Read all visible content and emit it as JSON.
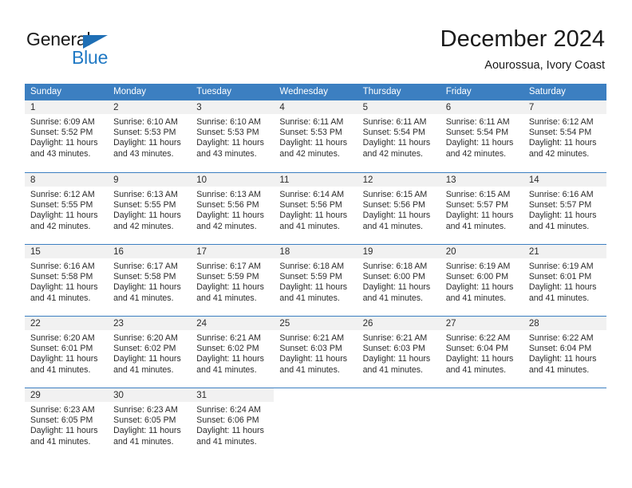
{
  "logo": {
    "word_one": "General",
    "word_two": "Blue",
    "triangle_icon": "triangle-icon",
    "color_dark": "#1a1a1a",
    "color_blue": "#2079c4"
  },
  "header": {
    "title": "December 2024",
    "subtitle": "Aourossua, Ivory Coast"
  },
  "theme": {
    "header_bg": "#3c7fc1",
    "daynum_bg": "#f1f1f1",
    "text": "#2b2b2b"
  },
  "calendar": {
    "weekday_headers": [
      "Sunday",
      "Monday",
      "Tuesday",
      "Wednesday",
      "Thursday",
      "Friday",
      "Saturday"
    ],
    "weeks": [
      [
        {
          "day": "1",
          "sunrise": "Sunrise: 6:09 AM",
          "sunset": "Sunset: 5:52 PM",
          "daylight_line1": "Daylight: 11 hours",
          "daylight_line2": "and 43 minutes."
        },
        {
          "day": "2",
          "sunrise": "Sunrise: 6:10 AM",
          "sunset": "Sunset: 5:53 PM",
          "daylight_line1": "Daylight: 11 hours",
          "daylight_line2": "and 43 minutes."
        },
        {
          "day": "3",
          "sunrise": "Sunrise: 6:10 AM",
          "sunset": "Sunset: 5:53 PM",
          "daylight_line1": "Daylight: 11 hours",
          "daylight_line2": "and 43 minutes."
        },
        {
          "day": "4",
          "sunrise": "Sunrise: 6:11 AM",
          "sunset": "Sunset: 5:53 PM",
          "daylight_line1": "Daylight: 11 hours",
          "daylight_line2": "and 42 minutes."
        },
        {
          "day": "5",
          "sunrise": "Sunrise: 6:11 AM",
          "sunset": "Sunset: 5:54 PM",
          "daylight_line1": "Daylight: 11 hours",
          "daylight_line2": "and 42 minutes."
        },
        {
          "day": "6",
          "sunrise": "Sunrise: 6:11 AM",
          "sunset": "Sunset: 5:54 PM",
          "daylight_line1": "Daylight: 11 hours",
          "daylight_line2": "and 42 minutes."
        },
        {
          "day": "7",
          "sunrise": "Sunrise: 6:12 AM",
          "sunset": "Sunset: 5:54 PM",
          "daylight_line1": "Daylight: 11 hours",
          "daylight_line2": "and 42 minutes."
        }
      ],
      [
        {
          "day": "8",
          "sunrise": "Sunrise: 6:12 AM",
          "sunset": "Sunset: 5:55 PM",
          "daylight_line1": "Daylight: 11 hours",
          "daylight_line2": "and 42 minutes."
        },
        {
          "day": "9",
          "sunrise": "Sunrise: 6:13 AM",
          "sunset": "Sunset: 5:55 PM",
          "daylight_line1": "Daylight: 11 hours",
          "daylight_line2": "and 42 minutes."
        },
        {
          "day": "10",
          "sunrise": "Sunrise: 6:13 AM",
          "sunset": "Sunset: 5:56 PM",
          "daylight_line1": "Daylight: 11 hours",
          "daylight_line2": "and 42 minutes."
        },
        {
          "day": "11",
          "sunrise": "Sunrise: 6:14 AM",
          "sunset": "Sunset: 5:56 PM",
          "daylight_line1": "Daylight: 11 hours",
          "daylight_line2": "and 41 minutes."
        },
        {
          "day": "12",
          "sunrise": "Sunrise: 6:15 AM",
          "sunset": "Sunset: 5:56 PM",
          "daylight_line1": "Daylight: 11 hours",
          "daylight_line2": "and 41 minutes."
        },
        {
          "day": "13",
          "sunrise": "Sunrise: 6:15 AM",
          "sunset": "Sunset: 5:57 PM",
          "daylight_line1": "Daylight: 11 hours",
          "daylight_line2": "and 41 minutes."
        },
        {
          "day": "14",
          "sunrise": "Sunrise: 6:16 AM",
          "sunset": "Sunset: 5:57 PM",
          "daylight_line1": "Daylight: 11 hours",
          "daylight_line2": "and 41 minutes."
        }
      ],
      [
        {
          "day": "15",
          "sunrise": "Sunrise: 6:16 AM",
          "sunset": "Sunset: 5:58 PM",
          "daylight_line1": "Daylight: 11 hours",
          "daylight_line2": "and 41 minutes."
        },
        {
          "day": "16",
          "sunrise": "Sunrise: 6:17 AM",
          "sunset": "Sunset: 5:58 PM",
          "daylight_line1": "Daylight: 11 hours",
          "daylight_line2": "and 41 minutes."
        },
        {
          "day": "17",
          "sunrise": "Sunrise: 6:17 AM",
          "sunset": "Sunset: 5:59 PM",
          "daylight_line1": "Daylight: 11 hours",
          "daylight_line2": "and 41 minutes."
        },
        {
          "day": "18",
          "sunrise": "Sunrise: 6:18 AM",
          "sunset": "Sunset: 5:59 PM",
          "daylight_line1": "Daylight: 11 hours",
          "daylight_line2": "and 41 minutes."
        },
        {
          "day": "19",
          "sunrise": "Sunrise: 6:18 AM",
          "sunset": "Sunset: 6:00 PM",
          "daylight_line1": "Daylight: 11 hours",
          "daylight_line2": "and 41 minutes."
        },
        {
          "day": "20",
          "sunrise": "Sunrise: 6:19 AM",
          "sunset": "Sunset: 6:00 PM",
          "daylight_line1": "Daylight: 11 hours",
          "daylight_line2": "and 41 minutes."
        },
        {
          "day": "21",
          "sunrise": "Sunrise: 6:19 AM",
          "sunset": "Sunset: 6:01 PM",
          "daylight_line1": "Daylight: 11 hours",
          "daylight_line2": "and 41 minutes."
        }
      ],
      [
        {
          "day": "22",
          "sunrise": "Sunrise: 6:20 AM",
          "sunset": "Sunset: 6:01 PM",
          "daylight_line1": "Daylight: 11 hours",
          "daylight_line2": "and 41 minutes."
        },
        {
          "day": "23",
          "sunrise": "Sunrise: 6:20 AM",
          "sunset": "Sunset: 6:02 PM",
          "daylight_line1": "Daylight: 11 hours",
          "daylight_line2": "and 41 minutes."
        },
        {
          "day": "24",
          "sunrise": "Sunrise: 6:21 AM",
          "sunset": "Sunset: 6:02 PM",
          "daylight_line1": "Daylight: 11 hours",
          "daylight_line2": "and 41 minutes."
        },
        {
          "day": "25",
          "sunrise": "Sunrise: 6:21 AM",
          "sunset": "Sunset: 6:03 PM",
          "daylight_line1": "Daylight: 11 hours",
          "daylight_line2": "and 41 minutes."
        },
        {
          "day": "26",
          "sunrise": "Sunrise: 6:21 AM",
          "sunset": "Sunset: 6:03 PM",
          "daylight_line1": "Daylight: 11 hours",
          "daylight_line2": "and 41 minutes."
        },
        {
          "day": "27",
          "sunrise": "Sunrise: 6:22 AM",
          "sunset": "Sunset: 6:04 PM",
          "daylight_line1": "Daylight: 11 hours",
          "daylight_line2": "and 41 minutes."
        },
        {
          "day": "28",
          "sunrise": "Sunrise: 6:22 AM",
          "sunset": "Sunset: 6:04 PM",
          "daylight_line1": "Daylight: 11 hours",
          "daylight_line2": "and 41 minutes."
        }
      ],
      [
        {
          "day": "29",
          "sunrise": "Sunrise: 6:23 AM",
          "sunset": "Sunset: 6:05 PM",
          "daylight_line1": "Daylight: 11 hours",
          "daylight_line2": "and 41 minutes."
        },
        {
          "day": "30",
          "sunrise": "Sunrise: 6:23 AM",
          "sunset": "Sunset: 6:05 PM",
          "daylight_line1": "Daylight: 11 hours",
          "daylight_line2": "and 41 minutes."
        },
        {
          "day": "31",
          "sunrise": "Sunrise: 6:24 AM",
          "sunset": "Sunset: 6:06 PM",
          "daylight_line1": "Daylight: 11 hours",
          "daylight_line2": "and 41 minutes."
        },
        {
          "day": "",
          "sunrise": "",
          "sunset": "",
          "daylight_line1": "",
          "daylight_line2": ""
        },
        {
          "day": "",
          "sunrise": "",
          "sunset": "",
          "daylight_line1": "",
          "daylight_line2": ""
        },
        {
          "day": "",
          "sunrise": "",
          "sunset": "",
          "daylight_line1": "",
          "daylight_line2": ""
        },
        {
          "day": "",
          "sunrise": "",
          "sunset": "",
          "daylight_line1": "",
          "daylight_line2": ""
        }
      ]
    ]
  }
}
